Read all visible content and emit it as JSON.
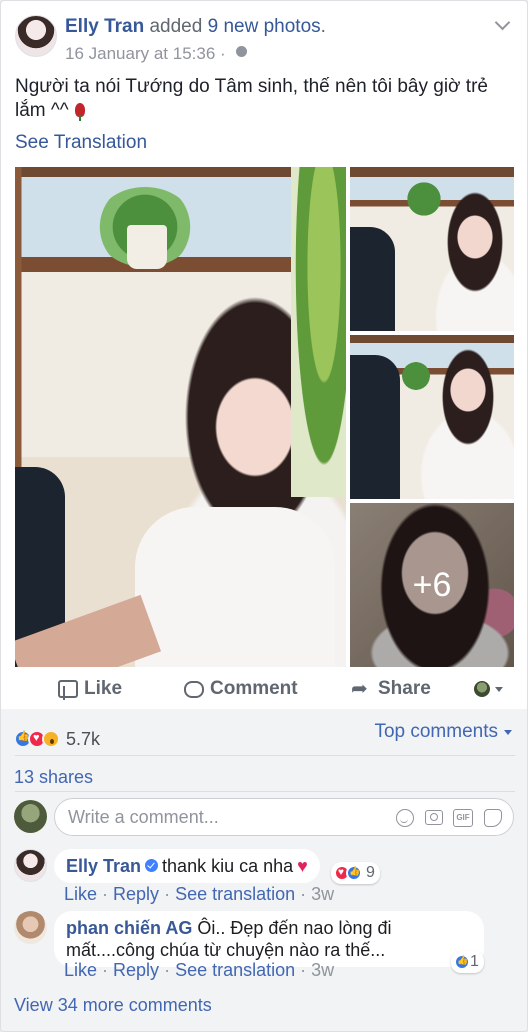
{
  "post": {
    "author": "Elly Tran",
    "action_text": " added ",
    "photo_count_link": "9 new photos",
    "action_suffix": ".",
    "timestamp": "16 January at 15:36",
    "separator": " · ",
    "text": "Người ta nói Tướng do Tâm sinh, thế nên tôi bây giờ trẻ lắm ^^",
    "see_translation": "See Translation",
    "more_photos_overlay": "+6"
  },
  "actions": {
    "like": "Like",
    "comment": "Comment",
    "share": "Share"
  },
  "feedback": {
    "reaction_count": "5.7k",
    "top_comments": "Top comments",
    "shares": "13 shares",
    "composer_placeholder": "Write a comment...",
    "gif_label": "GIF",
    "comments": [
      {
        "author": "Elly Tran",
        "text": "thank kiu ca nha",
        "reaction_count": "9",
        "like": "Like",
        "reply": "Reply",
        "see_translation": "See translation",
        "time": "3w"
      },
      {
        "author": "phan chiến AG",
        "text": "Ôi.. Đẹp đến nao lòng đi mất....công chúa từ chuyện nào ra thế...",
        "reaction_count": "1",
        "like": "Like",
        "reply": "Reply",
        "see_translation": "See translation",
        "time": "3w"
      }
    ],
    "view_more": "View 34 more comments"
  },
  "colors": {
    "link": "#365899",
    "accent": "#4267b2",
    "muted": "#90949c",
    "like_blue": "#3578e5",
    "love_red": "#f0284a",
    "wow_yellow": "#f7b125"
  },
  "icons": [
    "globe-icon",
    "chevron-down-icon",
    "rose-emoji-icon",
    "like-icon",
    "comment-icon",
    "share-icon",
    "emoji-icon",
    "camera-icon",
    "gif-icon",
    "sticker-icon",
    "verified-icon",
    "heart-emoji-icon"
  ]
}
